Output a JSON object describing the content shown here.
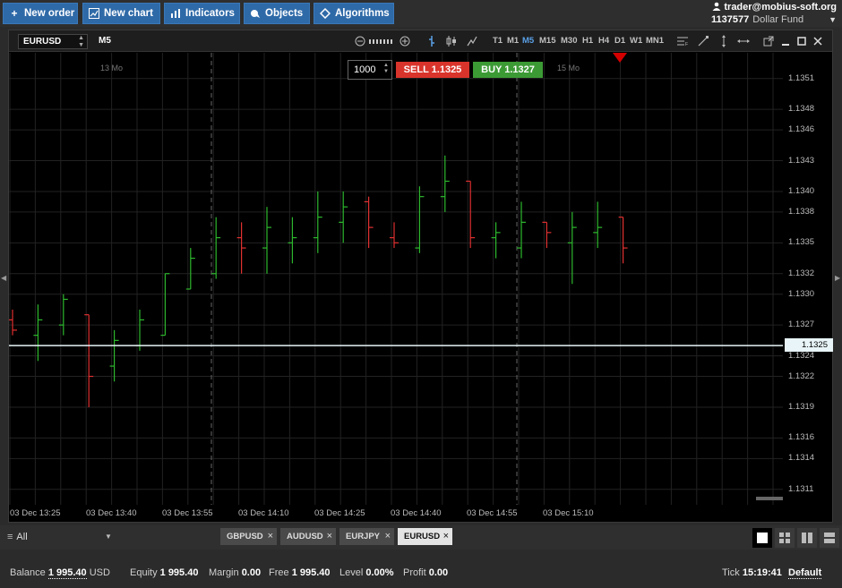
{
  "toolbar": {
    "new_order": "New order",
    "new_chart": "New chart",
    "indicators": "Indicators",
    "objects": "Objects",
    "algorithms": "Algorithms"
  },
  "account": {
    "email": "trader@mobius-soft.org",
    "id": "1137577",
    "fund": "Dollar Fund"
  },
  "chart": {
    "symbol": "EURUSD",
    "timeframe": "M5",
    "timeframes": [
      "T1",
      "M1",
      "M5",
      "M15",
      "M30",
      "H1",
      "H4",
      "D1",
      "W1",
      "MN1"
    ],
    "active_timeframe": "M5",
    "day_labels": [
      "13 Mo",
      "15 Mo"
    ],
    "current_price": "1.1325",
    "order": {
      "quantity": "1000",
      "sell_label": "SELL",
      "sell_price": "1.1325",
      "buy_label": "BUY",
      "buy_price": "1.1327"
    },
    "colors": {
      "up": "#2db82d",
      "down": "#e03030",
      "background": "#000000",
      "grid": "#222222",
      "price_line": "#e8f4f8"
    }
  },
  "chart_data": {
    "type": "candlestick",
    "symbol": "EURUSD",
    "timeframe": "M5",
    "ylim": [
      1.13095,
      1.13535
    ],
    "y_ticks": [
      "1.1351",
      "1.1348",
      "1.1346",
      "1.1343",
      "1.1340",
      "1.1338",
      "1.1335",
      "1.1332",
      "1.1330",
      "1.1327",
      "1.1324",
      "1.1322",
      "1.1319",
      "1.1316",
      "1.1314",
      "1.1311"
    ],
    "x_ticks": [
      "03 Dec 13:25",
      "03 Dec 13:40",
      "03 Dec 13:55",
      "03 Dec 14:10",
      "03 Dec 14:25",
      "03 Dec 14:40",
      "03 Dec 14:55",
      "03 Dec 15:10"
    ],
    "current_price": 1.1325,
    "bars": [
      {
        "o": 1.13275,
        "h": 1.13285,
        "l": 1.1326,
        "c": 1.13265
      },
      {
        "o": 1.1326,
        "h": 1.1329,
        "l": 1.13235,
        "c": 1.13275
      },
      {
        "o": 1.1327,
        "h": 1.133,
        "l": 1.1326,
        "c": 1.13295
      },
      {
        "o": 1.1328,
        "h": 1.1328,
        "l": 1.1319,
        "c": 1.1322
      },
      {
        "o": 1.1323,
        "h": 1.13265,
        "l": 1.13215,
        "c": 1.13255
      },
      {
        "o": 1.1325,
        "h": 1.13285,
        "l": 1.13245,
        "c": 1.13275
      },
      {
        "o": 1.1326,
        "h": 1.1332,
        "l": 1.1326,
        "c": 1.1332
      },
      {
        "o": 1.13305,
        "h": 1.13345,
        "l": 1.13305,
        "c": 1.13335
      },
      {
        "o": 1.1332,
        "h": 1.13375,
        "l": 1.13315,
        "c": 1.13355
      },
      {
        "o": 1.13355,
        "h": 1.1337,
        "l": 1.1332,
        "c": 1.13345
      },
      {
        "o": 1.13345,
        "h": 1.13385,
        "l": 1.1332,
        "c": 1.13365
      },
      {
        "o": 1.1335,
        "h": 1.13375,
        "l": 1.1333,
        "c": 1.13355
      },
      {
        "o": 1.13355,
        "h": 1.134,
        "l": 1.1334,
        "c": 1.13375
      },
      {
        "o": 1.1337,
        "h": 1.134,
        "l": 1.1335,
        "c": 1.13385
      },
      {
        "o": 1.1339,
        "h": 1.13395,
        "l": 1.13345,
        "c": 1.13365
      },
      {
        "o": 1.13355,
        "h": 1.1337,
        "l": 1.13345,
        "c": 1.1335
      },
      {
        "o": 1.13345,
        "h": 1.13405,
        "l": 1.1334,
        "c": 1.13395
      },
      {
        "o": 1.13395,
        "h": 1.13435,
        "l": 1.1338,
        "c": 1.1341
      },
      {
        "o": 1.1341,
        "h": 1.1341,
        "l": 1.13345,
        "c": 1.13355
      },
      {
        "o": 1.13355,
        "h": 1.1337,
        "l": 1.13335,
        "c": 1.1336
      },
      {
        "o": 1.13345,
        "h": 1.1339,
        "l": 1.13335,
        "c": 1.1337
      },
      {
        "o": 1.1337,
        "h": 1.1337,
        "l": 1.13345,
        "c": 1.1336
      },
      {
        "o": 1.1335,
        "h": 1.1338,
        "l": 1.1331,
        "c": 1.13365
      },
      {
        "o": 1.1336,
        "h": 1.1339,
        "l": 1.13345,
        "c": 1.13365
      },
      {
        "o": 1.13375,
        "h": 1.13375,
        "l": 1.1333,
        "c": 1.13345
      }
    ]
  },
  "tabs": {
    "filter": "All",
    "items": [
      "GBPUSD",
      "AUDUSD",
      "EURJPY",
      "EURUSD"
    ],
    "active": "EURUSD",
    "close_glyph": "×"
  },
  "status": {
    "balance_label": "Balance",
    "balance_value": "1 995.40",
    "balance_currency": "USD",
    "equity_label": "Equity",
    "equity_value": "1 995.40",
    "margin_label": "Margin",
    "margin_value": "0.00",
    "free_label": "Free",
    "free_value": "1 995.40",
    "level_label": "Level",
    "level_value": "0.00%",
    "profit_label": "Profit",
    "profit_value": "0.00",
    "tick_label": "Tick",
    "tick_value": "15:19:41",
    "default_label": "Default"
  }
}
